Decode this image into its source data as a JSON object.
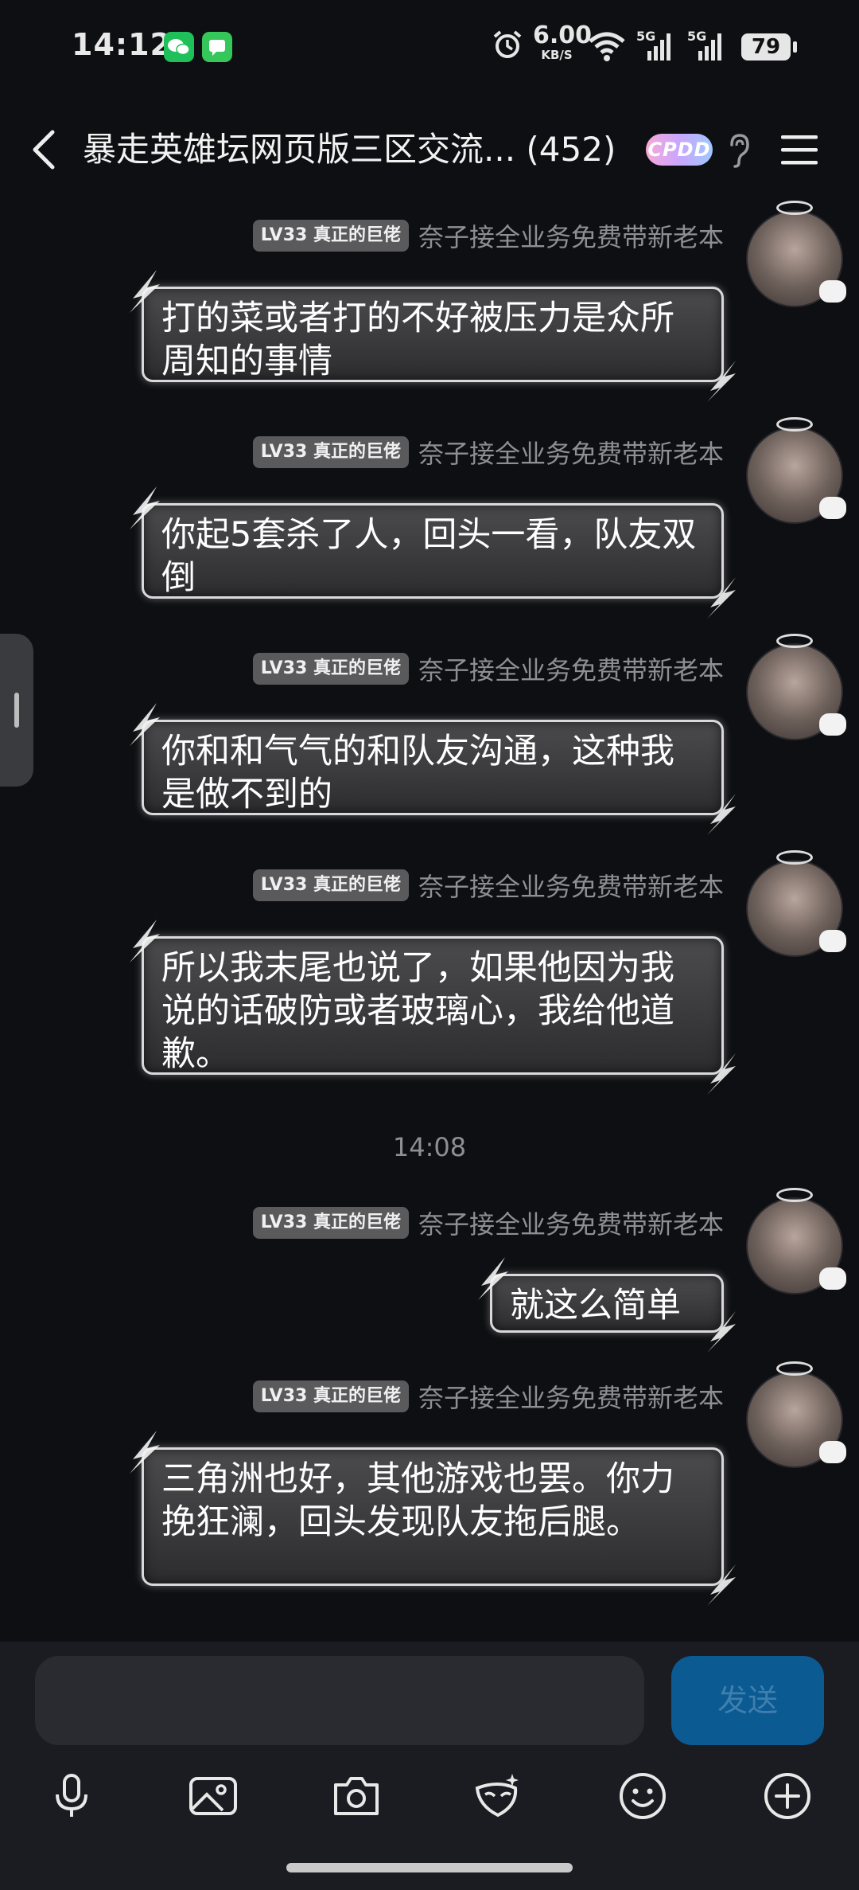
{
  "status_bar": {
    "time": "14:12",
    "net_speed_value": "6.00",
    "net_speed_unit": "KB/S",
    "signal_1_label": "5G",
    "signal_2_label": "5G",
    "battery": "79"
  },
  "header": {
    "title": "暴走英雄坛网页版三区交流... (452)",
    "badge": "CPDD"
  },
  "messages": [
    {
      "level": "LV33 真正的巨佬",
      "nickname": "奈子接全业务免费带新老本",
      "text": "打的菜或者打的不好被压力是众所周知的事情"
    },
    {
      "level": "LV33 真正的巨佬",
      "nickname": "奈子接全业务免费带新老本",
      "text": "你起5套杀了人，回头一看，队友双倒"
    },
    {
      "level": "LV33 真正的巨佬",
      "nickname": "奈子接全业务免费带新老本",
      "text": "你和和气气的和队友沟通，这种我是做不到的"
    },
    {
      "level": "LV33 真正的巨佬",
      "nickname": "奈子接全业务免费带新老本",
      "text": "所以我末尾也说了，如果他因为我说的话破防或者玻璃心，我给他道歉。"
    },
    {
      "level": "LV33 真正的巨佬",
      "nickname": "奈子接全业务免费带新老本",
      "text": "就这么简单"
    },
    {
      "level": "LV33 真正的巨佬",
      "nickname": "奈子接全业务免费带新老本",
      "text": "三角洲也好，其他游戏也罢。你力挽狂澜，回头发现队友拖后腿。"
    }
  ],
  "timestamp": "14:08",
  "composer": {
    "send_label": "发送"
  },
  "toolbar_icons": [
    "microphone-icon",
    "image-icon",
    "camera-icon",
    "mask-icon",
    "emoji-icon",
    "plus-icon"
  ]
}
